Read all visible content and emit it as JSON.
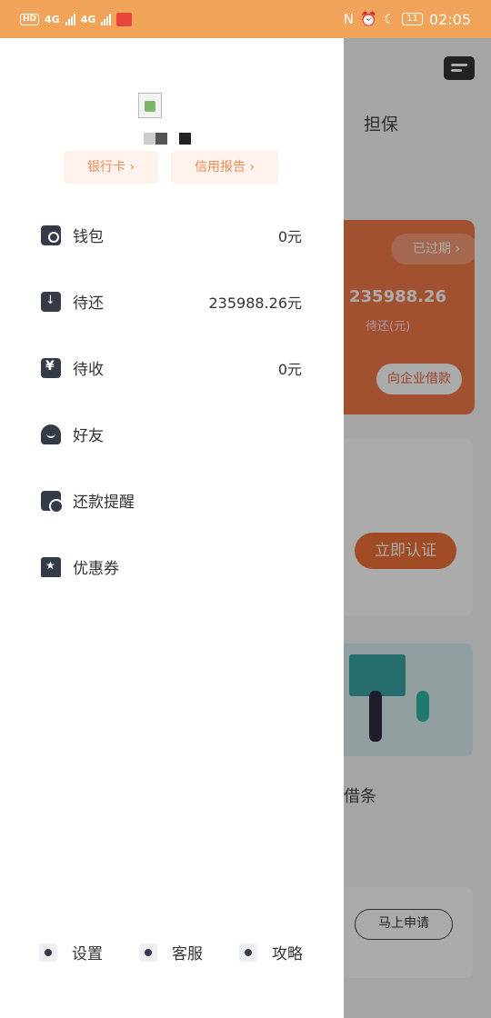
{
  "status_bar": {
    "hd": "HD",
    "net1": "4G",
    "net2": "4G",
    "nfc": "N",
    "battery": "11",
    "time": "02:05"
  },
  "background": {
    "tab_label": "担保",
    "card": {
      "expired_label": "已过期",
      "amount": "235988.26",
      "amount_label": "待还(元)",
      "borrow_button": "向企业借款"
    },
    "certify_button": "立即认证",
    "section_title": "借条",
    "apply_button": "马上申请"
  },
  "drawer": {
    "quick_links": [
      {
        "label": "银行卡 ›"
      },
      {
        "label": "信用报告 ›"
      }
    ],
    "menu": [
      {
        "label": "钱包",
        "value": "0元",
        "icon": "wallet-icon"
      },
      {
        "label": "待还",
        "value": "235988.26元",
        "icon": "repay-icon"
      },
      {
        "label": "待收",
        "value": "0元",
        "icon": "receive-icon"
      },
      {
        "label": "好友",
        "value": "",
        "icon": "friend-icon"
      },
      {
        "label": "还款提醒",
        "value": "",
        "icon": "reminder-icon"
      },
      {
        "label": "优惠券",
        "value": "",
        "icon": "coupon-icon"
      }
    ],
    "bottom": [
      {
        "label": "设置",
        "icon": "settings-icon"
      },
      {
        "label": "客服",
        "icon": "headset-icon"
      },
      {
        "label": "攻略",
        "icon": "guide-icon"
      }
    ]
  },
  "colors": {
    "status_bar": "#f2a35a",
    "accent": "#f07a48",
    "icon_dark": "#353a48"
  }
}
